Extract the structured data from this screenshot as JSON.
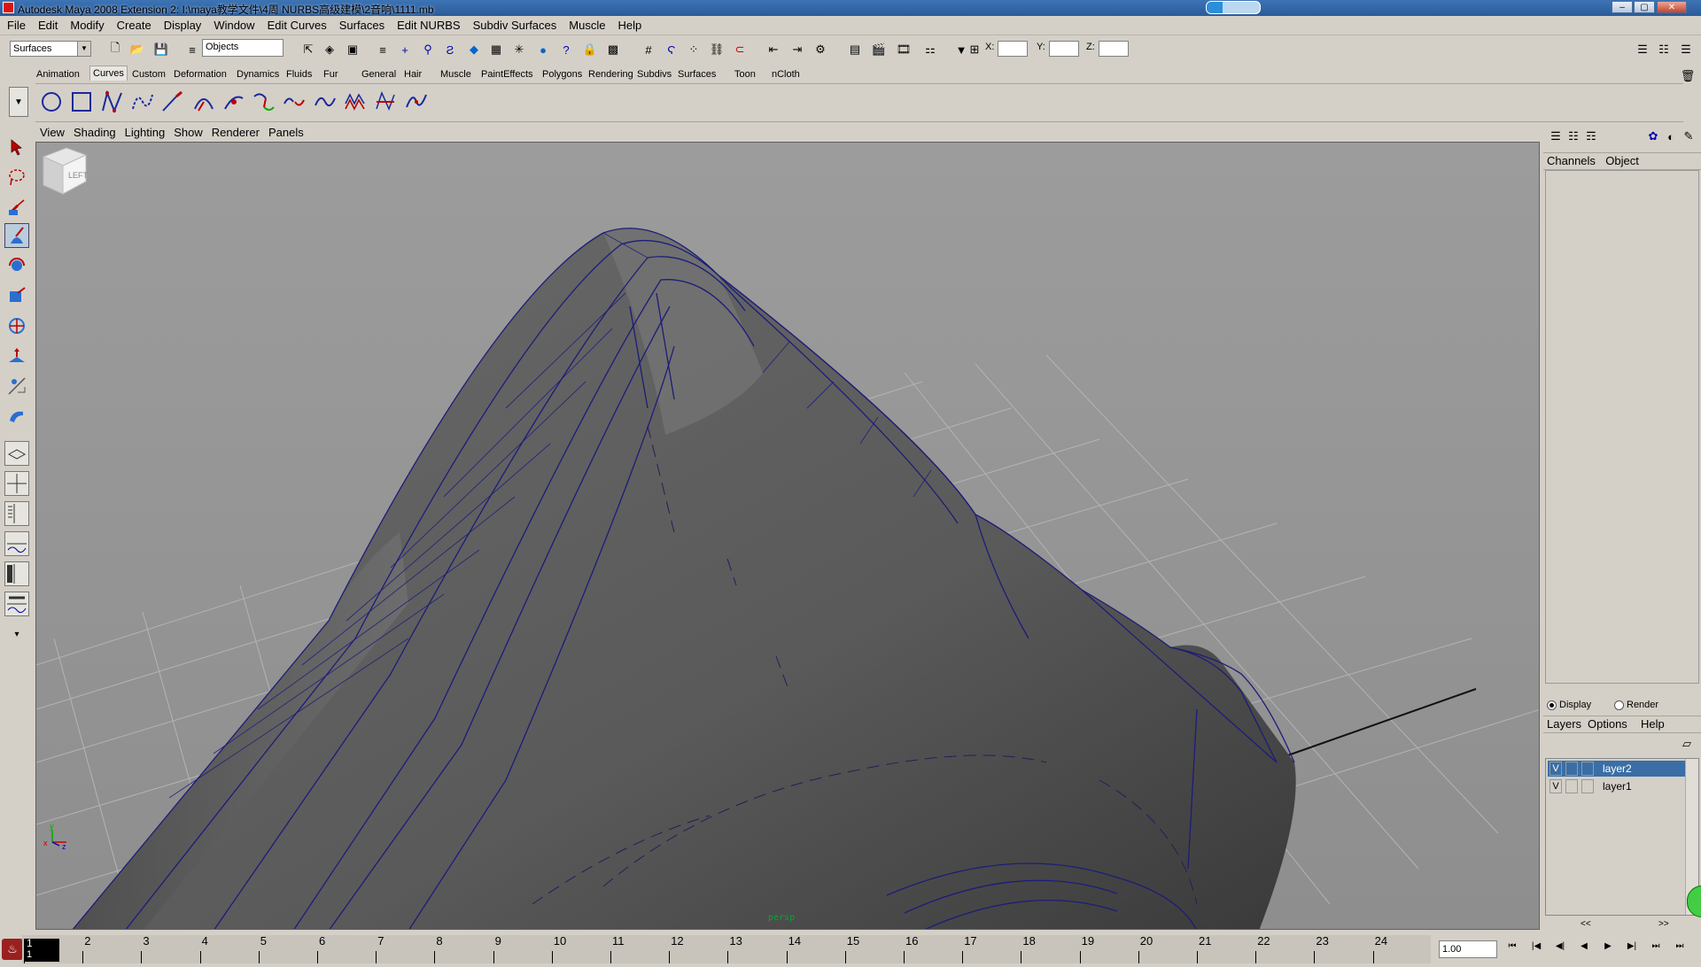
{
  "window": {
    "title": "Autodesk Maya 2008 Extension 2: I:\\maya教学文件\\4周 NURBS高级建模\\2音响\\1111.mb",
    "minimize": "‒",
    "maximize": "▢",
    "close": "✕",
    "progress": 0.3
  },
  "menubar": [
    "File",
    "Edit",
    "Modify",
    "Create",
    "Display",
    "Window",
    "Edit Curves",
    "Surfaces",
    "Edit NURBS",
    "Subdiv Surfaces",
    "Muscle",
    "Help"
  ],
  "statusline": {
    "menuset": "Surfaces",
    "selection_mode": "Objects",
    "x_label": "X:",
    "y_label": "Y:",
    "z_label": "Z:"
  },
  "shelf_tabs": [
    "Animation",
    "Curves",
    "Custom",
    "Deformation",
    "Dynamics",
    "Fluids",
    "Fur",
    "General",
    "Hair",
    "Muscle",
    "PaintEffects",
    "Polygons",
    "Rendering",
    "Subdivs",
    "Surfaces",
    "Toon",
    "nCloth"
  ],
  "active_shelf_tab": "Curves",
  "shelf_icons": [
    "nurbs-circle-icon",
    "nurbs-square-icon",
    "cv-curve-icon",
    "ep-curve-icon",
    "pencil-curve-icon",
    "arc-icon",
    "arc-two-point-icon",
    "attach-curves-icon",
    "detach-curves-icon",
    "insert-knot-icon",
    "offset-curve-icon",
    "rebuild-curve-icon",
    "fillet-curve-icon"
  ],
  "panel_menu": [
    "View",
    "Shading",
    "Lighting",
    "Show",
    "Renderer",
    "Panels"
  ],
  "viewport": {
    "camera": "persp",
    "viewcube_face": "LEFT",
    "axis_x": "x",
    "axis_y": "y",
    "axis_z": "z"
  },
  "channel_box": {
    "tabs": [
      "Channels",
      "Object"
    ]
  },
  "layer_editor": {
    "display_label": "Display",
    "render_label": "Render",
    "display_selected": true,
    "menus": [
      "Layers",
      "Options",
      "Help"
    ],
    "layers": [
      {
        "visible": "V",
        "name": "layer2",
        "selected": true
      },
      {
        "visible": "V",
        "name": "layer1",
        "selected": false
      }
    ],
    "scroll_left": "<<",
    "scroll_right": ">>"
  },
  "timeline": {
    "current_frame": "1",
    "current_frame_top": "1",
    "frame_labels": [
      "2",
      "3",
      "4",
      "5",
      "6",
      "7",
      "8",
      "9",
      "10",
      "11",
      "12",
      "13",
      "14",
      "15",
      "16",
      "17",
      "18",
      "19",
      "20",
      "21",
      "22",
      "23",
      "24"
    ],
    "range_start": 1,
    "range_end": 24,
    "current_time_field": "1.00",
    "buttons": [
      "⏮",
      "|◀",
      "◀|",
      "◀",
      "▶",
      "▶|",
      "⏭",
      "⏭"
    ]
  },
  "colors": {
    "ui_gray": "#d4d0c8",
    "viewport_bg": "#9a9a9a",
    "wire": "#1a1a8c",
    "selected_layer": "#3a6ea5"
  }
}
